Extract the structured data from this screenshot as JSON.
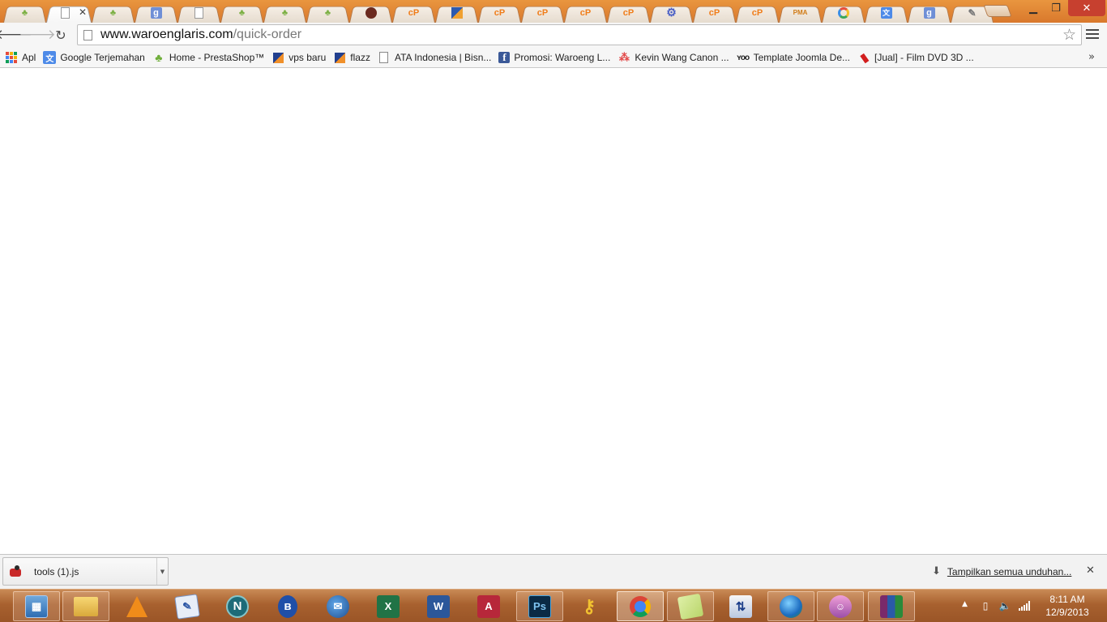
{
  "browser": {
    "tabs": [
      {
        "icon": "prestashop-leaf-icon",
        "active": false
      },
      {
        "icon": "blank-page-icon",
        "active": true
      },
      {
        "icon": "prestashop-leaf-icon",
        "active": false
      },
      {
        "icon": "google-g-icon",
        "active": false
      },
      {
        "icon": "blank-page-icon",
        "active": false
      },
      {
        "icon": "prestashop-leaf-icon",
        "active": false
      },
      {
        "icon": "prestashop-leaf-icon",
        "active": false
      },
      {
        "icon": "prestashop-leaf-icon",
        "active": false
      },
      {
        "icon": "dark-circle-icon",
        "active": false
      },
      {
        "icon": "cpanel-icon",
        "active": false
      },
      {
        "icon": "ui-icon",
        "active": false
      },
      {
        "icon": "cpanel-icon",
        "active": false
      },
      {
        "icon": "cpanel-icon",
        "active": false
      },
      {
        "icon": "cpanel-icon",
        "active": false
      },
      {
        "icon": "cpanel-icon",
        "active": false
      },
      {
        "icon": "gear-icon",
        "active": false
      },
      {
        "icon": "cpanel-icon",
        "active": false
      },
      {
        "icon": "cpanel-icon",
        "active": false
      },
      {
        "icon": "phpmyadmin-icon",
        "active": false
      },
      {
        "icon": "chrome-extension-icon",
        "active": false
      },
      {
        "icon": "translate-icon",
        "active": false
      },
      {
        "icon": "google-g-icon",
        "active": false
      },
      {
        "icon": "pin-icon",
        "active": false
      }
    ],
    "cpanel_text": "cP",
    "google_text": "g",
    "pma_text": "PMA",
    "active_tab_close": "✕",
    "url_host": "www.waroenglaris.com",
    "url_path": "/quick-order"
  },
  "bookmarks": [
    {
      "label": "Apl",
      "icon": "apps-icon"
    },
    {
      "label": "Google Terjemahan",
      "icon": "translate-icon"
    },
    {
      "label": "Home - PrestaShop™",
      "icon": "prestashop-leaf-icon"
    },
    {
      "label": "vps baru",
      "icon": "ui-icon"
    },
    {
      "label": "flazz",
      "icon": "ui-icon"
    },
    {
      "label": "ATA Indonesia | Bisn...",
      "icon": "blank-page-icon"
    },
    {
      "label": "Promosi: Waroeng L...",
      "icon": "facebook-icon"
    },
    {
      "label": "Kevin Wang Canon ...",
      "icon": "dots-icon"
    },
    {
      "label": "Template Joomla De...",
      "icon": "yoo-icon"
    },
    {
      "label": "[Jual] - Film DVD 3D ...",
      "icon": "red-flag-icon"
    }
  ],
  "bookmark_more": "»",
  "download_shelf": {
    "file_name": "tools (1).js",
    "show_all": "Tampilkan semua unduhan...",
    "close": "✕"
  },
  "taskbar": {
    "apps": [
      {
        "name": "control-panel",
        "state": "open"
      },
      {
        "name": "file-explorer",
        "state": "open"
      },
      {
        "name": "vlc",
        "state": "pinned"
      },
      {
        "name": "notepad",
        "state": "pinned"
      },
      {
        "name": "netscape",
        "state": "pinned"
      },
      {
        "name": "bluetooth",
        "state": "pinned"
      },
      {
        "name": "thunderbird",
        "state": "pinned"
      },
      {
        "name": "excel",
        "state": "pinned"
      },
      {
        "name": "word",
        "state": "pinned"
      },
      {
        "name": "access",
        "state": "pinned"
      },
      {
        "name": "photoshop",
        "state": "open"
      },
      {
        "name": "keys",
        "state": "pinned"
      },
      {
        "name": "chrome",
        "state": "active"
      },
      {
        "name": "sticky-notes",
        "state": "open"
      },
      {
        "name": "network",
        "state": "pinned"
      },
      {
        "name": "globe",
        "state": "open"
      },
      {
        "name": "pidgin",
        "state": "open"
      },
      {
        "name": "winrar",
        "state": "open"
      }
    ],
    "netscape_text": "N",
    "bluetooth_text": "ʙ",
    "excel_text": "X",
    "word_text": "W",
    "access_text": "A",
    "photoshop_text": "Ps",
    "time": "8:11 AM",
    "date": "12/9/2013"
  }
}
